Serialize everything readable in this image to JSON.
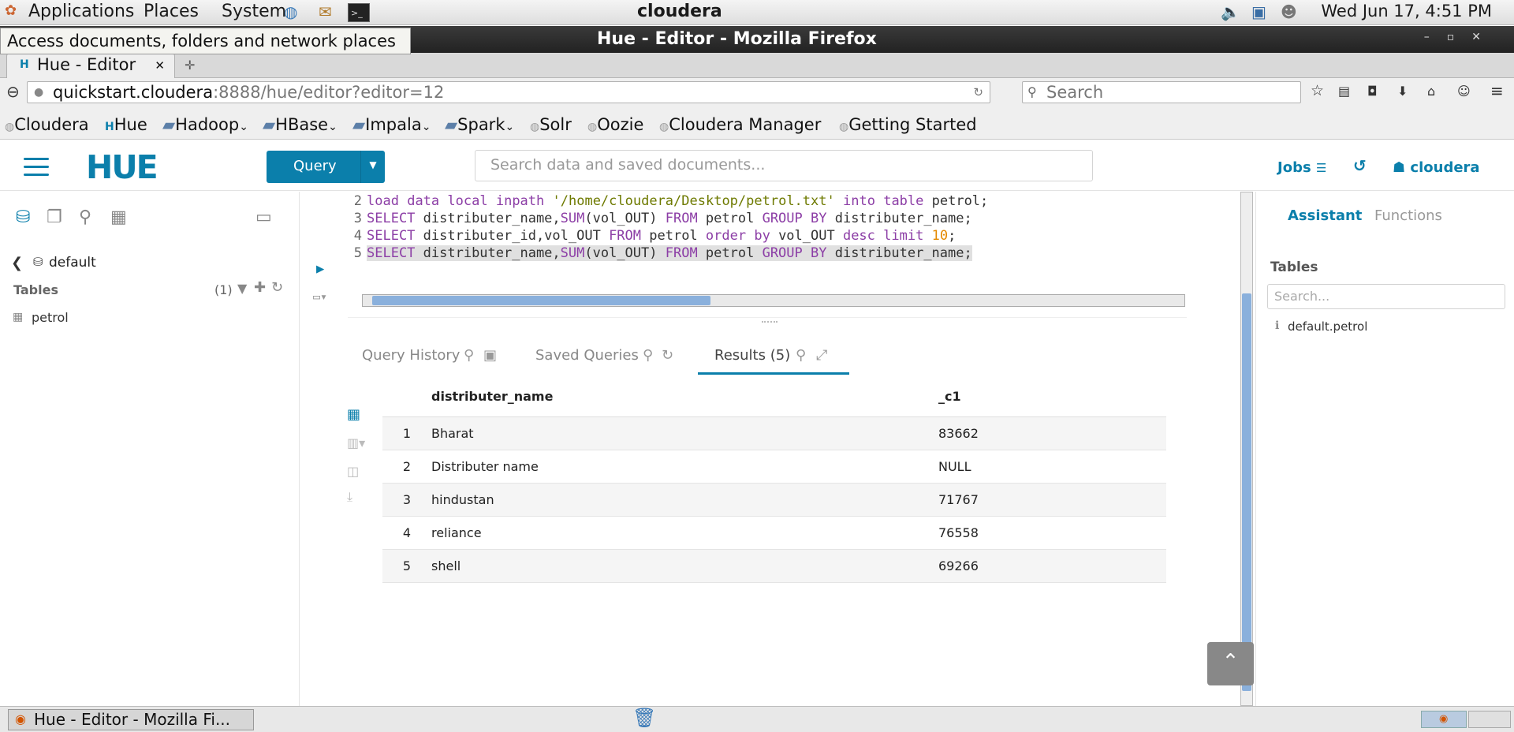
{
  "panel": {
    "applications": "Applications",
    "places": "Places",
    "system": "System",
    "hostname": "cloudera",
    "clock": "Wed Jun 17,  4:51 PM"
  },
  "window": {
    "title": "Hue - Editor - Mozilla Firefox"
  },
  "tooltip": "Access documents, folders and network places",
  "browser": {
    "tab_title": "Hue - Editor",
    "url_host": "quickstart.cloudera",
    "url_rest": ":8888/hue/editor?editor=12",
    "search_placeholder": "Search",
    "bookmarks": [
      "Cloudera",
      "Hue",
      "Hadoop",
      "HBase",
      "Impala",
      "Spark",
      "Solr",
      "Oozie",
      "Cloudera Manager",
      "Getting Started"
    ]
  },
  "hue": {
    "logo": "HUE",
    "query_button": "Query",
    "search_placeholder": "Search data and saved documents...",
    "jobs": "Jobs",
    "user": "cloudera"
  },
  "left": {
    "database": "default",
    "tables_label": "Tables",
    "tables_count": "(1)",
    "tables": [
      "petrol"
    ]
  },
  "editor": {
    "line_numbers": [
      "2",
      "3",
      "4",
      "5"
    ],
    "lines": [
      "load data local inpath '/home/cloudera/Desktop/petrol.txt' into table petrol;",
      "SELECT distributer_name,SUM(vol_OUT) FROM petrol GROUP BY distributer_name;",
      "SELECT distributer_id,vol_OUT FROM petrol order by vol_OUT desc limit 10;",
      "SELECT distributer_name,SUM(vol_OUT) FROM petrol GROUP BY distributer_name;"
    ]
  },
  "results": {
    "tabs": [
      "Query History",
      "Saved Queries",
      "Results (5)"
    ],
    "columns": [
      "distributer_name",
      "_c1"
    ],
    "rows": [
      [
        "1",
        "Bharat",
        "83662"
      ],
      [
        "2",
        "Distributer name",
        "NULL"
      ],
      [
        "3",
        "hindustan",
        "71767"
      ],
      [
        "4",
        "reliance",
        "76558"
      ],
      [
        "5",
        "shell",
        "69266"
      ]
    ]
  },
  "right": {
    "tabs": [
      "Assistant",
      "Functions"
    ],
    "tables_label": "Tables",
    "search_placeholder": "Search...",
    "items": [
      "default.petrol"
    ]
  },
  "taskbar": {
    "window_button": "Hue - Editor - Mozilla Fi..."
  },
  "colors": {
    "accent": "#0b7fab",
    "keyword": "#8c3ea6",
    "string": "#6e7a00",
    "number": "#e48900"
  }
}
